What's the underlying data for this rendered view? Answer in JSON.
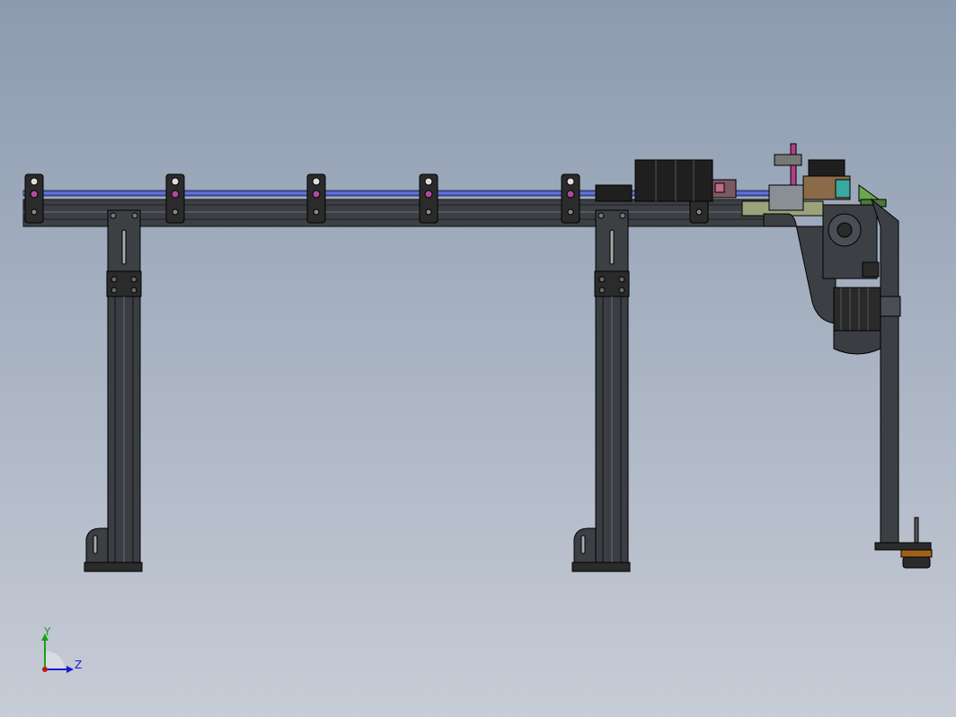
{
  "triad": {
    "y_label": "Y",
    "z_label": "Z",
    "y_color": "#1aa01a",
    "z_color": "#1a1ad0",
    "x_color": "#c01818"
  },
  "model": {
    "frame_color": "#3c3f44",
    "frame_edge": "#111111",
    "rail_color": "#4a5ac0",
    "bracket_color": "#2b2b2b",
    "motor_color": "#2a2a2a",
    "plate_color": "#9aa37a",
    "accent_green": "#6aa84f",
    "accent_magenta": "#b0408a",
    "accent_teal": "#3aa7a0",
    "accent_brown": "#8a6a48",
    "pad_color": "#a0601c"
  }
}
